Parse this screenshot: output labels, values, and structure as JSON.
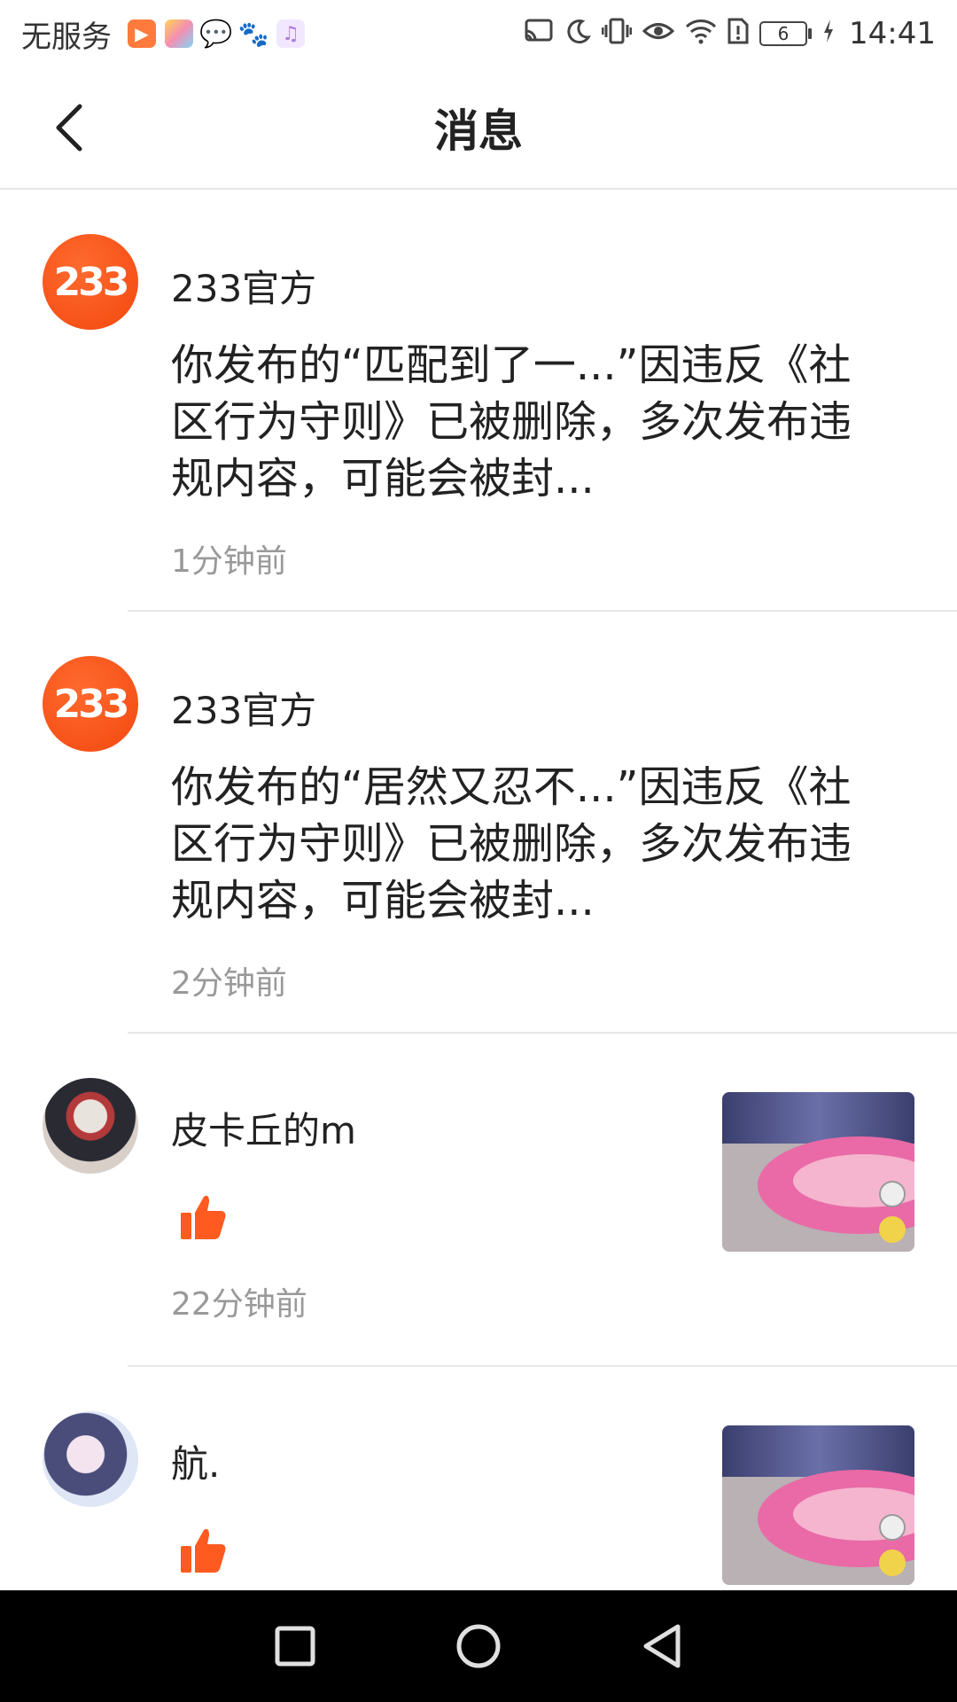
{
  "status_bar": {
    "carrier": "无服务",
    "battery_level": "6",
    "time": "14:41"
  },
  "header": {
    "title": "消息"
  },
  "messages": [
    {
      "sender": "233官方",
      "avatar_text": "233",
      "content": "你发布的“匹配到了一...”因违反《社区行为守则》已被删除，多次发布违规内容，可能会被封...",
      "time": "1分钟前"
    },
    {
      "sender": "233官方",
      "avatar_text": "233",
      "content": "你发布的“居然又忍不...”因违反《社区行为守则》已被删除，多次发布违规内容，可能会被封...",
      "time": "2分钟前"
    },
    {
      "sender": "皮卡丘的m",
      "type": "like",
      "time": "22分钟前"
    },
    {
      "sender": "航.",
      "type": "like"
    }
  ],
  "colors": {
    "brand_orange": "#f2480f",
    "like_orange": "#ff5a1f",
    "time_gray": "#999999"
  }
}
